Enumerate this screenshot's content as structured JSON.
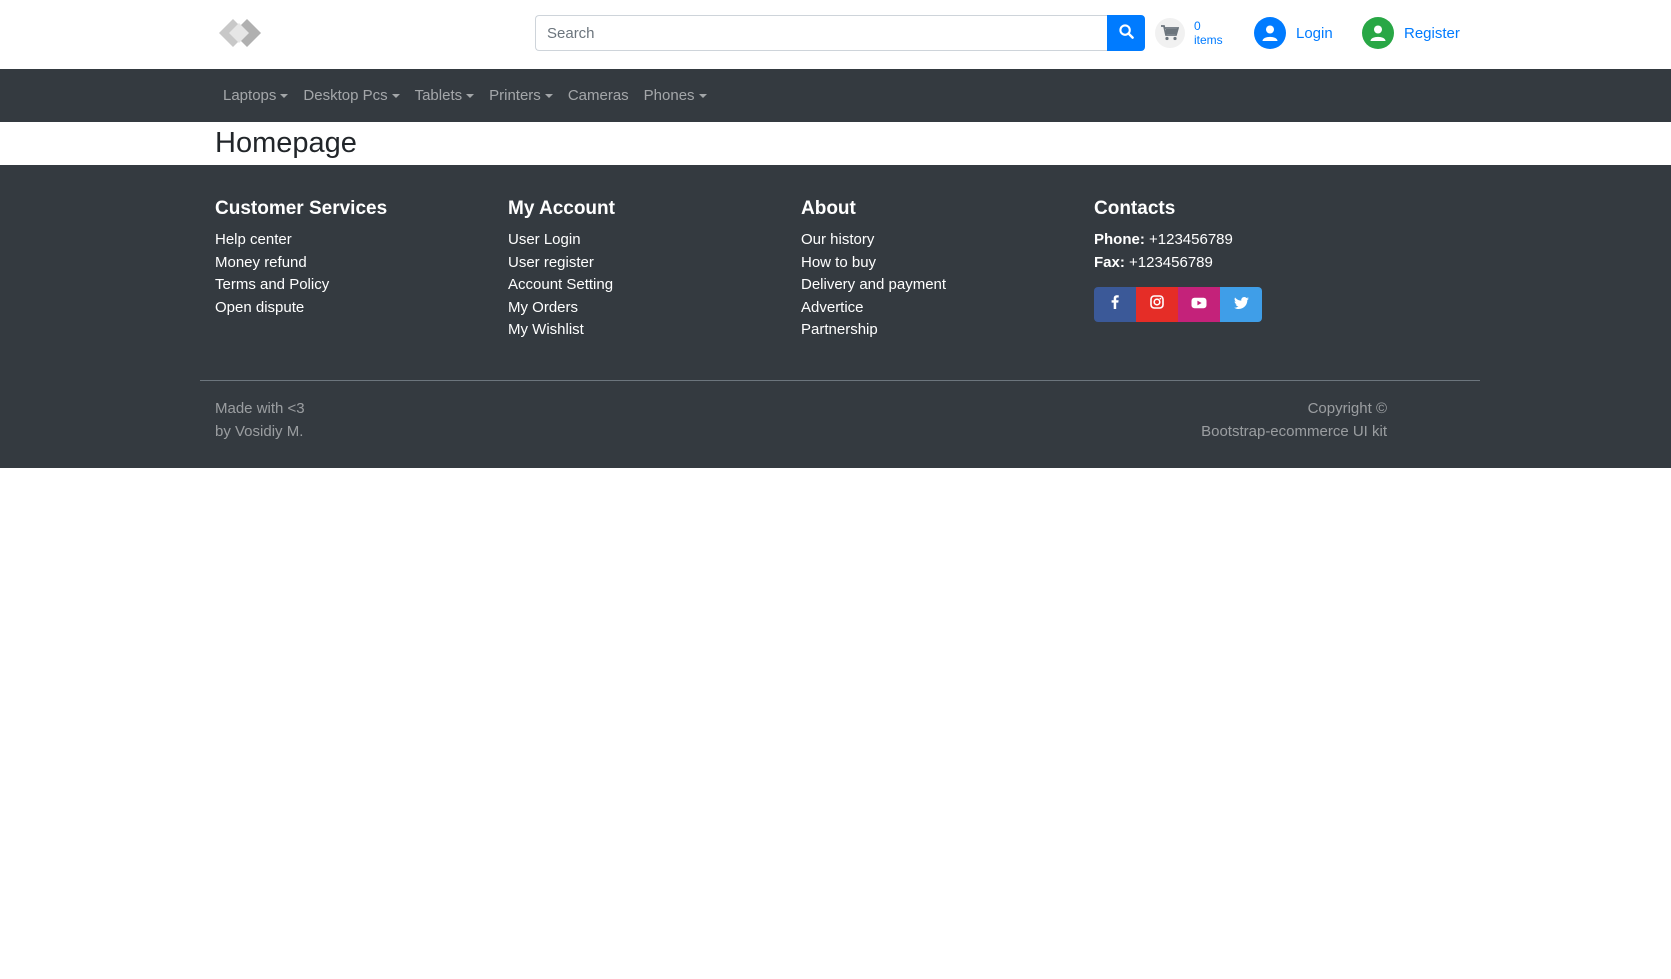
{
  "header": {
    "search_placeholder": "Search",
    "cart_count": "0",
    "cart_label": "items",
    "login_label": "Login",
    "register_label": "Register"
  },
  "nav": {
    "items": [
      {
        "label": "Laptops",
        "dropdown": true
      },
      {
        "label": "Desktop Pcs",
        "dropdown": true
      },
      {
        "label": "Tablets",
        "dropdown": true
      },
      {
        "label": "Printers",
        "dropdown": true
      },
      {
        "label": "Cameras",
        "dropdown": false
      },
      {
        "label": "Phones",
        "dropdown": true
      }
    ]
  },
  "page": {
    "title": "Homepage"
  },
  "footer": {
    "customer_services": {
      "title": "Customer Services",
      "links": [
        "Help center",
        "Money refund",
        "Terms and Policy",
        "Open dispute"
      ]
    },
    "my_account": {
      "title": "My Account",
      "links": [
        "User Login",
        "User register",
        "Account Setting",
        "My Orders",
        "My Wishlist"
      ]
    },
    "about": {
      "title": "About",
      "links": [
        "Our history",
        "How to buy",
        "Delivery and payment",
        "Advertice",
        "Partnership"
      ]
    },
    "contacts": {
      "title": "Contacts",
      "phone_label": "Phone:",
      "phone": "+123456789",
      "fax_label": "Fax:",
      "fax": "+123456789"
    },
    "social_icons": [
      "facebook-icon",
      "instagram-icon",
      "youtube-icon",
      "twitter-icon"
    ],
    "bottom_left_line1": "Made with <3",
    "bottom_left_line2": "by Vosidiy M.",
    "bottom_right_line1": "Copyright ©",
    "bottom_right_line2": "Bootstrap-ecommerce UI kit"
  },
  "colors": {
    "primary": "#007bff",
    "success": "#28a745",
    "dark": "#343a40",
    "facebook": "#3b5998",
    "instagram": "#e52d27",
    "youtube": "#c4227a",
    "twitter": "#3f9ee8"
  }
}
